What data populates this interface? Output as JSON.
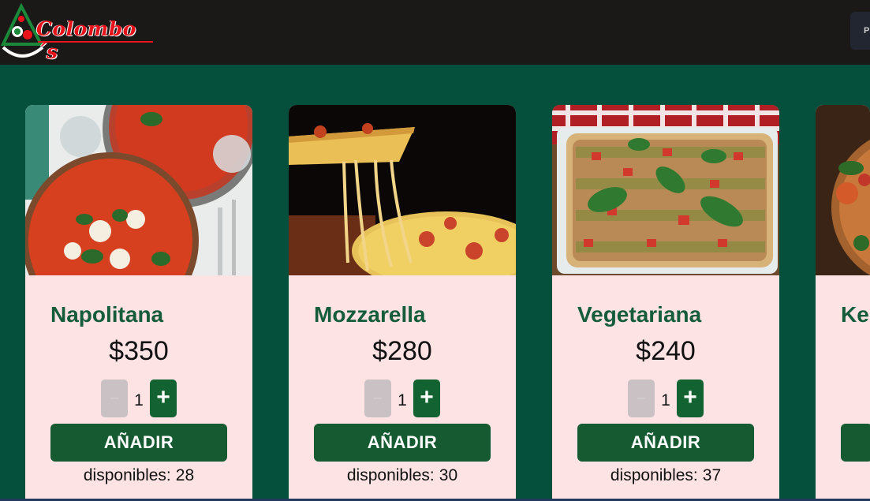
{
  "header": {
    "brand": "Colombo´s",
    "nav_button_label": "P"
  },
  "colors": {
    "header_bg": "#1b1818",
    "page_bg": "#05503c",
    "card_bg": "#fde3e3",
    "title_green": "#145c3a",
    "button_green": "#155a30",
    "logo_red": "#e8121b"
  },
  "products": [
    {
      "name": "Napolitana",
      "price": "$350",
      "quantity": "1",
      "minus_label": "−",
      "plus_label": "+",
      "add_label": "AÑADIR",
      "stock_label": "disponibles:",
      "stock": "28",
      "image": "napolitana-pizza-photo"
    },
    {
      "name": "Mozzarella",
      "price": "$280",
      "quantity": "1",
      "minus_label": "−",
      "plus_label": "+",
      "add_label": "AÑADIR",
      "stock_label": "disponibles:",
      "stock": "30",
      "image": "mozzarella-pizza-photo"
    },
    {
      "name": "Vegetariana",
      "price": "$240",
      "quantity": "1",
      "minus_label": "−",
      "plus_label": "+",
      "add_label": "AÑADIR",
      "stock_label": "disponibles:",
      "stock": "37",
      "image": "vegetariana-pizza-photo"
    },
    {
      "name": "Ke",
      "price": "",
      "quantity": "",
      "minus_label": "",
      "plus_label": "",
      "add_label": "",
      "stock_label": "",
      "stock": "",
      "image": "partial-pizza-photo"
    }
  ]
}
